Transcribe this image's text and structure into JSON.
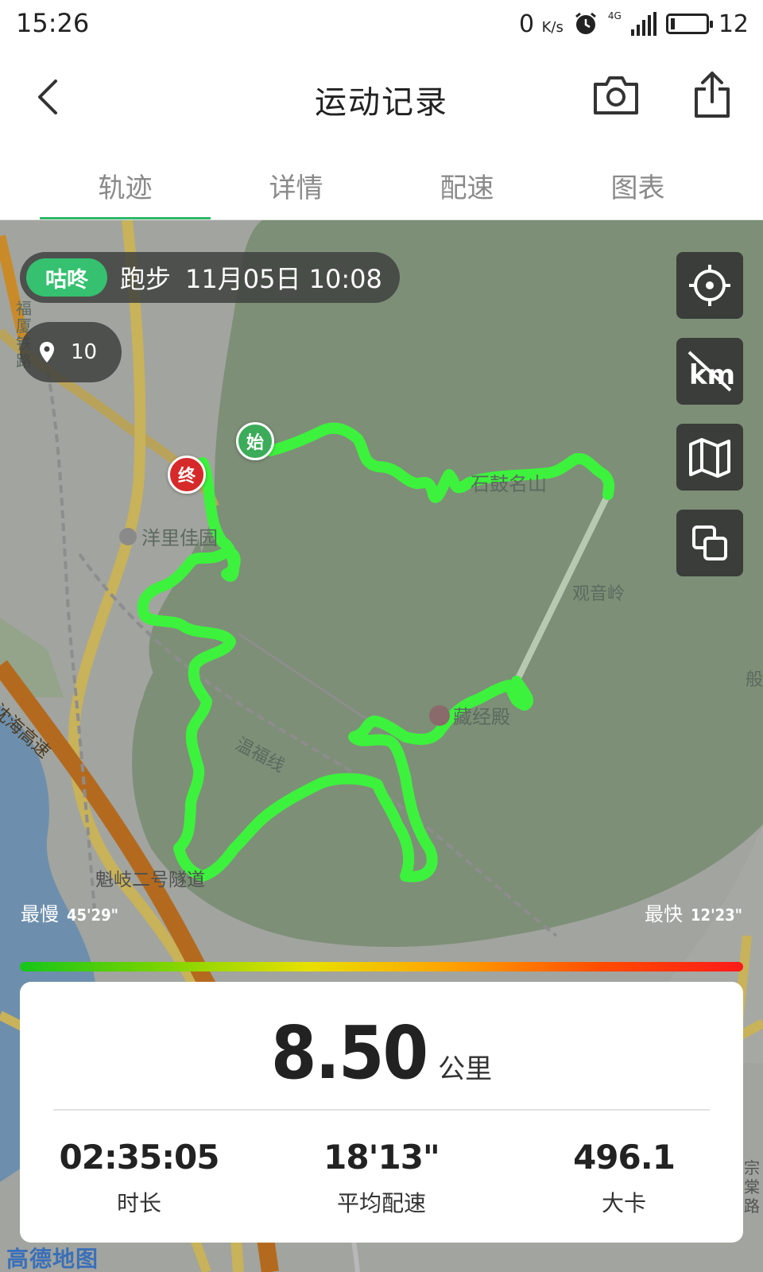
{
  "status_bar": {
    "time": "15:26",
    "network_speed": "0",
    "speed_unit": "K/s",
    "network_type": "4G",
    "battery": "12"
  },
  "header": {
    "title": "运动记录",
    "back_icon": "back-arrow-icon",
    "camera_icon": "camera-icon",
    "share_icon": "share-icon"
  },
  "tabs": [
    {
      "label": "轨迹",
      "active": true
    },
    {
      "label": "详情",
      "active": false
    },
    {
      "label": "配速",
      "active": false
    },
    {
      "label": "图表",
      "active": false
    }
  ],
  "map": {
    "brand": "咕咚",
    "activity_type": "跑步",
    "date_time": "11月05日 10:08",
    "photo_count": "10",
    "start_label": "始",
    "end_label": "终",
    "place_labels": {
      "yangli": "洋里佳园",
      "guanyin": "观音岭",
      "cangjing": "藏经殿",
      "wenfu": "温福线",
      "kuiqi": "魁岐二号隧道",
      "gushan": "石鼓名山",
      "fuxia": "福厦铁路",
      "hangyan": "沈海高速",
      "ban": "般",
      "zongtang": "宗棠路"
    },
    "controls": [
      "locate-icon",
      "km-toggle-icon",
      "map-type-icon",
      "layers-icon"
    ],
    "track_color": "#3df23d",
    "attribution": "高德地图"
  },
  "pace": {
    "slowest_label": "最慢",
    "slowest_value": "45'29\"",
    "fastest_label": "最快",
    "fastest_value": "12'23\""
  },
  "summary": {
    "distance": "8.50",
    "distance_unit": "公里",
    "stats": [
      {
        "value": "02:35:05",
        "label": "时长"
      },
      {
        "value": "18'13\"",
        "label": "平均配速"
      },
      {
        "value": "496.1",
        "label": "大卡"
      }
    ]
  }
}
